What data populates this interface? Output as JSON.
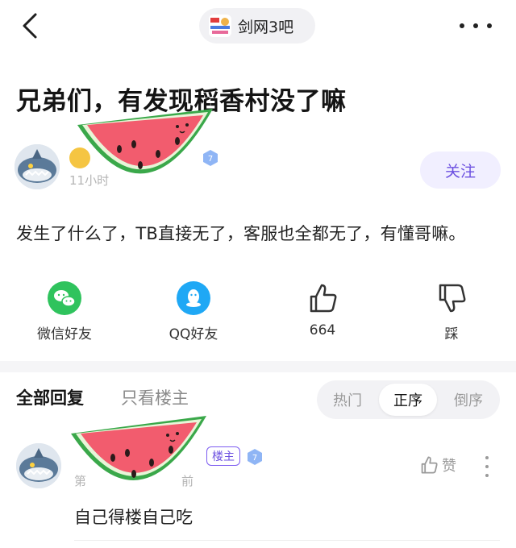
{
  "topbar": {
    "forum_name": "剑网3吧",
    "back_icon": "chevron-left-icon",
    "more_icon": "more-horizontal-icon"
  },
  "post": {
    "title": "兄弟们，有发现稻香村没了嘛",
    "time_partial": "11小时",
    "follow_label": "关注",
    "body": "发生了什么了，TB直接无了，客服也全都无了，有懂哥嘛。"
  },
  "actions": {
    "wechat_label": "微信好友",
    "qq_label": "QQ好友",
    "like_count": "664",
    "dislike_label": "踩"
  },
  "replies": {
    "tab_all": "全部回复",
    "tab_op_only": "只看楼主",
    "sort_hot": "热门",
    "sort_asc": "正序",
    "sort_desc": "倒序",
    "items": [
      {
        "floor_partial": "第",
        "floor_suffix": "前",
        "op_badge": "楼主",
        "like_label": "赞",
        "text": "自己得楼自己吃"
      }
    ]
  },
  "colors": {
    "accent": "#6b4fe0",
    "follow_bg": "#f1efff",
    "wechat": "#2fc35d",
    "qq": "#1fa8f5",
    "watermelon_flesh": "#f25c6e",
    "watermelon_rind": "#3aa84a"
  }
}
